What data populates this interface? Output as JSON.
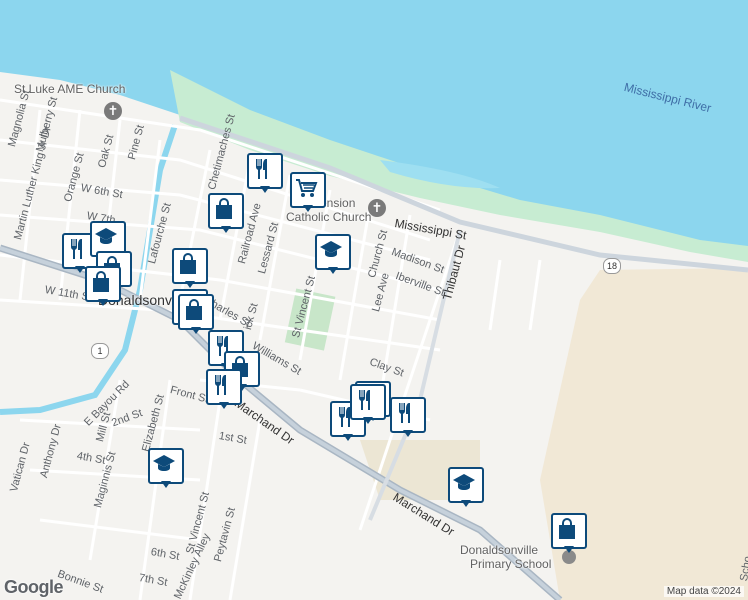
{
  "map": {
    "attribution": "Map data ©2024",
    "logo": "Google",
    "water_label": "Mississippi River",
    "poi_labels": {
      "church_ame": "St Luke AME Church",
      "church_ascension_1": "Ascension",
      "church_ascension_2": "Catholic Church",
      "school_1": "Donaldsonville",
      "school_2": "Primary School",
      "town": "Donaldsonv"
    },
    "streets": {
      "magnolia": "Magnolia St",
      "mulberry": "Mulberry St",
      "mlk": "Martin Luther King Jr Dr",
      "orange": "Orange St",
      "oak": "Oak St",
      "pine": "Pine St",
      "w6th": "W 6th St",
      "w7th": "W 7th",
      "chetimaches": "Chetimaches St",
      "railroad": "Railroad Ave",
      "lafourche": "Lafourche St",
      "lessard": "Lessard St",
      "mississippi": "Mississippi St",
      "madison": "Madison St",
      "church": "Church St",
      "iberville": "Iberville St",
      "thibaut": "Thibaut Dr",
      "lee": "Lee Ave",
      "st_vincent": "St Vincent St",
      "w11th": "W 11th St",
      "charles": "Charles St",
      "williams": "Williams St",
      "clay": "Clay St",
      "marchand_1": "Marchand Dr",
      "marchand_2": "Marchand Dr",
      "front": "Front St",
      "e_bayou": "E Bayou Rd",
      "mill": "Mill St",
      "second": "2nd St",
      "fourth": "4th St",
      "first": "1st St",
      "anthony": "Anthony Dr",
      "vatican": "Vatican Dr",
      "maginnis": "Maginnis St",
      "elizabeth": "Elizabeth St",
      "st_vincent_2": "St Vincent St",
      "peytavin": "Peytavin St",
      "mckinley": "McKinley Alley",
      "sixth": "6th St",
      "seventh": "7th St",
      "bonnie": "Bonnie St",
      "ick": "ick St",
      "scho": "Scho"
    },
    "shields": {
      "hwy18": "18",
      "hwy1": "1"
    },
    "pins": [
      {
        "type": "restaurant-icon"
      },
      {
        "type": "grocery-icon"
      },
      {
        "type": "shopping-icon"
      },
      {
        "type": "school-icon"
      },
      {
        "type": "shopping-icon"
      },
      {
        "type": "restaurant-icon"
      },
      {
        "type": "school-icon"
      },
      {
        "type": "shopping-icon"
      },
      {
        "type": "shopping-icon"
      },
      {
        "type": "shopping-icon"
      },
      {
        "type": "shopping-icon"
      },
      {
        "type": "restaurant-icon"
      },
      {
        "type": "shopping-icon"
      },
      {
        "type": "restaurant-icon"
      },
      {
        "type": "restaurant-icon"
      },
      {
        "type": "shopping-icon"
      },
      {
        "type": "restaurant-icon"
      },
      {
        "type": "restaurant-icon"
      },
      {
        "type": "school-icon"
      },
      {
        "type": "school-icon"
      },
      {
        "type": "shopping-icon"
      }
    ]
  }
}
